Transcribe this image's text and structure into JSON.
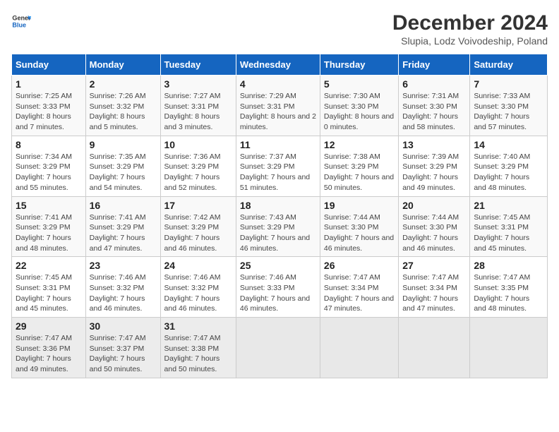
{
  "logo": {
    "text_general": "General",
    "text_blue": "Blue"
  },
  "title": "December 2024",
  "subtitle": "Slupia, Lodz Voivodeship, Poland",
  "days_of_week": [
    "Sunday",
    "Monday",
    "Tuesday",
    "Wednesday",
    "Thursday",
    "Friday",
    "Saturday"
  ],
  "weeks": [
    [
      {
        "day": "1",
        "sunrise": "7:25 AM",
        "sunset": "3:33 PM",
        "daylight": "8 hours and 7 minutes."
      },
      {
        "day": "2",
        "sunrise": "7:26 AM",
        "sunset": "3:32 PM",
        "daylight": "8 hours and 5 minutes."
      },
      {
        "day": "3",
        "sunrise": "7:27 AM",
        "sunset": "3:31 PM",
        "daylight": "8 hours and 3 minutes."
      },
      {
        "day": "4",
        "sunrise": "7:29 AM",
        "sunset": "3:31 PM",
        "daylight": "8 hours and 2 minutes."
      },
      {
        "day": "5",
        "sunrise": "7:30 AM",
        "sunset": "3:30 PM",
        "daylight": "8 hours and 0 minutes."
      },
      {
        "day": "6",
        "sunrise": "7:31 AM",
        "sunset": "3:30 PM",
        "daylight": "7 hours and 58 minutes."
      },
      {
        "day": "7",
        "sunrise": "7:33 AM",
        "sunset": "3:30 PM",
        "daylight": "7 hours and 57 minutes."
      }
    ],
    [
      {
        "day": "8",
        "sunrise": "7:34 AM",
        "sunset": "3:29 PM",
        "daylight": "7 hours and 55 minutes."
      },
      {
        "day": "9",
        "sunrise": "7:35 AM",
        "sunset": "3:29 PM",
        "daylight": "7 hours and 54 minutes."
      },
      {
        "day": "10",
        "sunrise": "7:36 AM",
        "sunset": "3:29 PM",
        "daylight": "7 hours and 52 minutes."
      },
      {
        "day": "11",
        "sunrise": "7:37 AM",
        "sunset": "3:29 PM",
        "daylight": "7 hours and 51 minutes."
      },
      {
        "day": "12",
        "sunrise": "7:38 AM",
        "sunset": "3:29 PM",
        "daylight": "7 hours and 50 minutes."
      },
      {
        "day": "13",
        "sunrise": "7:39 AM",
        "sunset": "3:29 PM",
        "daylight": "7 hours and 49 minutes."
      },
      {
        "day": "14",
        "sunrise": "7:40 AM",
        "sunset": "3:29 PM",
        "daylight": "7 hours and 48 minutes."
      }
    ],
    [
      {
        "day": "15",
        "sunrise": "7:41 AM",
        "sunset": "3:29 PM",
        "daylight": "7 hours and 48 minutes."
      },
      {
        "day": "16",
        "sunrise": "7:41 AM",
        "sunset": "3:29 PM",
        "daylight": "7 hours and 47 minutes."
      },
      {
        "day": "17",
        "sunrise": "7:42 AM",
        "sunset": "3:29 PM",
        "daylight": "7 hours and 46 minutes."
      },
      {
        "day": "18",
        "sunrise": "7:43 AM",
        "sunset": "3:29 PM",
        "daylight": "7 hours and 46 minutes."
      },
      {
        "day": "19",
        "sunrise": "7:44 AM",
        "sunset": "3:30 PM",
        "daylight": "7 hours and 46 minutes."
      },
      {
        "day": "20",
        "sunrise": "7:44 AM",
        "sunset": "3:30 PM",
        "daylight": "7 hours and 46 minutes."
      },
      {
        "day": "21",
        "sunrise": "7:45 AM",
        "sunset": "3:31 PM",
        "daylight": "7 hours and 45 minutes."
      }
    ],
    [
      {
        "day": "22",
        "sunrise": "7:45 AM",
        "sunset": "3:31 PM",
        "daylight": "7 hours and 45 minutes."
      },
      {
        "day": "23",
        "sunrise": "7:46 AM",
        "sunset": "3:32 PM",
        "daylight": "7 hours and 46 minutes."
      },
      {
        "day": "24",
        "sunrise": "7:46 AM",
        "sunset": "3:32 PM",
        "daylight": "7 hours and 46 minutes."
      },
      {
        "day": "25",
        "sunrise": "7:46 AM",
        "sunset": "3:33 PM",
        "daylight": "7 hours and 46 minutes."
      },
      {
        "day": "26",
        "sunrise": "7:47 AM",
        "sunset": "3:34 PM",
        "daylight": "7 hours and 47 minutes."
      },
      {
        "day": "27",
        "sunrise": "7:47 AM",
        "sunset": "3:34 PM",
        "daylight": "7 hours and 47 minutes."
      },
      {
        "day": "28",
        "sunrise": "7:47 AM",
        "sunset": "3:35 PM",
        "daylight": "7 hours and 48 minutes."
      }
    ],
    [
      {
        "day": "29",
        "sunrise": "7:47 AM",
        "sunset": "3:36 PM",
        "daylight": "7 hours and 49 minutes."
      },
      {
        "day": "30",
        "sunrise": "7:47 AM",
        "sunset": "3:37 PM",
        "daylight": "7 hours and 50 minutes."
      },
      {
        "day": "31",
        "sunrise": "7:47 AM",
        "sunset": "3:38 PM",
        "daylight": "7 hours and 50 minutes."
      },
      null,
      null,
      null,
      null
    ]
  ]
}
